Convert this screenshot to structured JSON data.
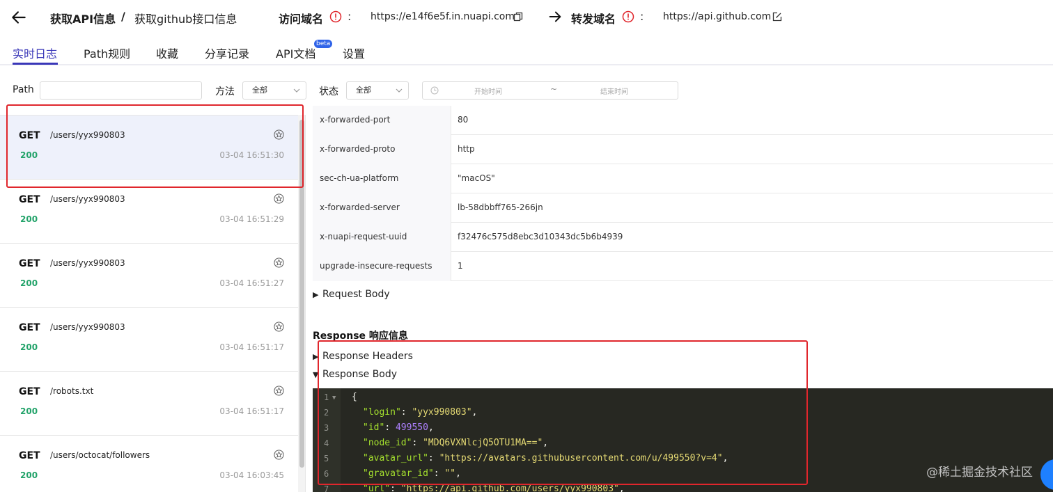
{
  "header": {
    "title_main": "获取API信息",
    "title_sep": "/",
    "title_sub": "获取github接口信息",
    "visit_label": "访问域名",
    "visit_domain": "https://e14f6e5f.in.nuapi.com",
    "forward_label": "转发域名",
    "forward_domain": "https://api.github.com",
    "colon": ":"
  },
  "tabs": [
    {
      "label": "实时日志",
      "active": true
    },
    {
      "label": "Path规则"
    },
    {
      "label": "收藏"
    },
    {
      "label": "分享记录"
    },
    {
      "label": "API文档"
    },
    {
      "label": "设置"
    }
  ],
  "beta_badge": "beta",
  "filters": {
    "path_label": "Path",
    "path_value": "",
    "method_label": "方法",
    "method_value": "全部",
    "status_label": "状态",
    "status_value": "全部",
    "start_placeholder": "开始时间",
    "range_sep": "~",
    "end_placeholder": "结束时间"
  },
  "requests": [
    {
      "method": "GET",
      "path": "/users/yyx990803",
      "status": "200",
      "time": "03-04 16:51:30",
      "selected": true
    },
    {
      "method": "GET",
      "path": "/users/yyx990803",
      "status": "200",
      "time": "03-04 16:51:29"
    },
    {
      "method": "GET",
      "path": "/users/yyx990803",
      "status": "200",
      "time": "03-04 16:51:27"
    },
    {
      "method": "GET",
      "path": "/users/yyx990803",
      "status": "200",
      "time": "03-04 16:51:17"
    },
    {
      "method": "GET",
      "path": "/robots.txt",
      "status": "200",
      "time": "03-04 16:51:17"
    },
    {
      "method": "GET",
      "path": "/users/octocat/followers",
      "status": "200",
      "time": "03-04 16:03:45"
    }
  ],
  "request_headers": [
    {
      "key": "x-forwarded-port",
      "value": "80"
    },
    {
      "key": "x-forwarded-proto",
      "value": "http"
    },
    {
      "key": "sec-ch-ua-platform",
      "value": "\"macOS\""
    },
    {
      "key": "x-forwarded-server",
      "value": "lb-58dbbff765-266jn"
    },
    {
      "key": "x-nuapi-request-uuid",
      "value": "f32476c575d8ebc3d10343dc5b6b4939"
    },
    {
      "key": "upgrade-insecure-requests",
      "value": "1"
    }
  ],
  "request_body_label": "Request Body",
  "response_title": "Response 响应信息",
  "response_headers_label": "Response Headers",
  "response_body_label": "Response Body",
  "code": {
    "line_numbers": [
      "1",
      "2",
      "3",
      "4",
      "5",
      "6",
      "7"
    ],
    "open_brace": "{",
    "lines": [
      {
        "key": "\"login\"",
        "sep": ": ",
        "value": "\"yyx990803\"",
        "type": "s",
        "tail": ","
      },
      {
        "key": "\"id\"",
        "sep": ": ",
        "value": "499550",
        "type": "n",
        "tail": ","
      },
      {
        "key": "\"node_id\"",
        "sep": ": ",
        "value": "\"MDQ6VXNlcjQ5OTU1MA==\"",
        "type": "s",
        "tail": ","
      },
      {
        "key": "\"avatar_url\"",
        "sep": ": ",
        "value": "\"https://avatars.githubusercontent.com/u/499550?v=4\"",
        "type": "s",
        "tail": ","
      },
      {
        "key": "\"gravatar_id\"",
        "sep": ": ",
        "value": "\"\"",
        "type": "s",
        "tail": ","
      },
      {
        "key": "\"url\"",
        "sep": ": ",
        "value": "\"https://api.github.com/users/yyx990803\"",
        "type": "s",
        "tail": ","
      }
    ]
  },
  "watermark": "@稀土掘金技术社区",
  "colors": {
    "accent": "#3a37b8",
    "status_ok": "#23a36a",
    "highlight": "#e0262c",
    "code_bg": "#272822"
  }
}
